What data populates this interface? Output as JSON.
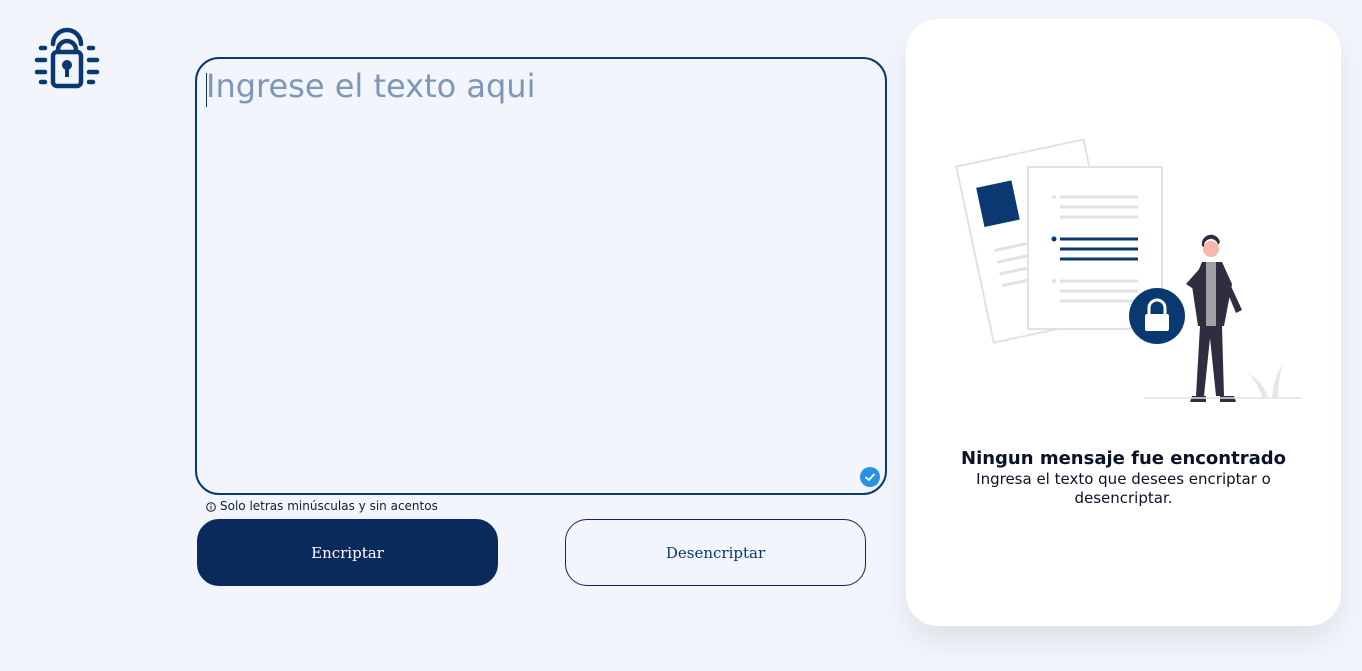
{
  "colors": {
    "background": "#f2f5fc",
    "primary": "#0a3871",
    "button_dark": "#0a2a5e",
    "placeholder": "#7e96b7",
    "panel": "#ffffff",
    "check": "#2b8fe5"
  },
  "logo": {
    "icon": "lock-circuit-logo-icon"
  },
  "editor": {
    "placeholder": "Ingrese el texto aqui",
    "value": "",
    "status_icon": "check-circle-icon"
  },
  "hint": {
    "icon": "info-circle-icon",
    "text": "Solo letras minúsculas y sin acentos"
  },
  "actions": {
    "encrypt_label": "Encriptar",
    "decrypt_label": "Desencriptar"
  },
  "output": {
    "illustration": "person-with-locked-documents-illustration",
    "title": "Ningun mensaje fue encontrado",
    "description": "Ingresa el texto que desees encriptar o desencriptar."
  }
}
